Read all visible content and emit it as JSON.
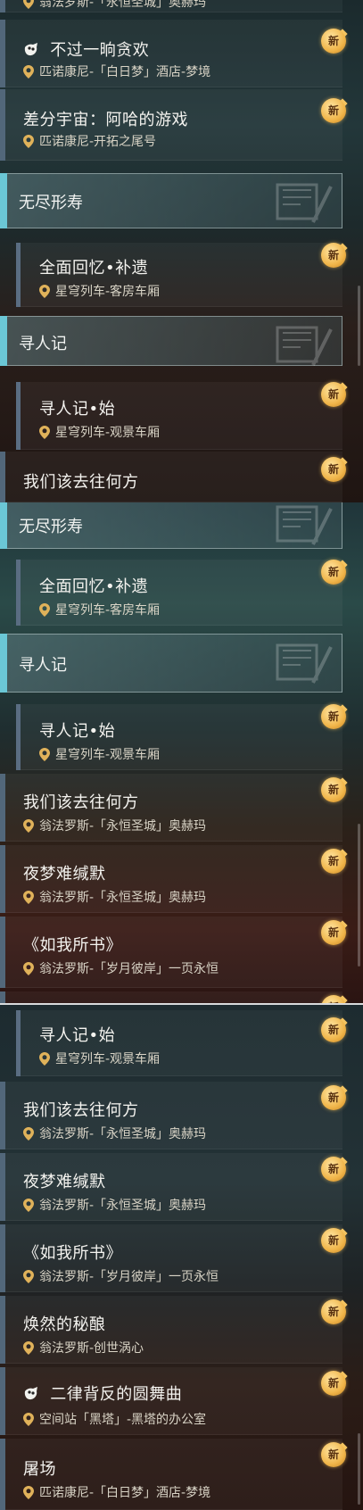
{
  "panel1": {
    "top_loc": "翁法罗斯-「永恒圣城」奥赫玛",
    "rows": [
      {
        "title": "不过一晌贪欢",
        "loc": "匹诺康尼-「白日梦」酒店-梦境",
        "badge": "新",
        "icon": "dream-mask-icon"
      },
      {
        "title": "差分宇宙：阿哈的游戏",
        "loc": "匹诺康尼-开拓之尾号",
        "badge": "新"
      }
    ],
    "section1": "无尽形寿",
    "sub1": {
      "title": "全面回忆•补遗",
      "loc": "星穹列车-客房车厢",
      "badge": "新"
    },
    "section2": "寻人记",
    "sub2": {
      "title": "寻人记•始",
      "loc": "星穹列车-观景车厢",
      "badge": "新"
    },
    "row_last": {
      "title": "我们该去往何方",
      "badge": "新"
    }
  },
  "panel2": {
    "section1": "无尽形寿",
    "sub1": {
      "title": "全面回忆•补遗",
      "loc": "星穹列车-客房车厢",
      "badge": "新"
    },
    "section2": "寻人记",
    "sub2": {
      "title": "寻人记•始",
      "loc": "星穹列车-观景车厢",
      "badge": "新"
    },
    "rows": [
      {
        "title": "我们该去往何方",
        "loc": "翁法罗斯-「永恒圣城」奥赫玛",
        "badge": "新"
      },
      {
        "title": "夜梦难缄默",
        "loc": "翁法罗斯-「永恒圣城」奥赫玛",
        "badge": "新"
      },
      {
        "title": "《如我所书》",
        "loc": "翁法罗斯-「岁月彼岸」一页永恒",
        "badge": "新"
      }
    ],
    "partial_badge": "新"
  },
  "panel3": {
    "sub": {
      "title": "寻人记•始",
      "loc": "星穹列车-观景车厢",
      "badge": "新"
    },
    "rows": [
      {
        "title": "我们该去往何方",
        "loc": "翁法罗斯-「永恒圣城」奥赫玛",
        "badge": "新"
      },
      {
        "title": "夜梦难缄默",
        "loc": "翁法罗斯-「永恒圣城」奥赫玛",
        "badge": "新"
      },
      {
        "title": "《如我所书》",
        "loc": "翁法罗斯-「岁月彼岸」一页永恒",
        "badge": "新"
      },
      {
        "title": "焕然的秘酿",
        "loc": "翁法罗斯-创世涡心",
        "badge": "新"
      },
      {
        "title": "二律背反的圆舞曲",
        "loc": "空间站「黑塔」-黑塔的办公室",
        "badge": "新",
        "icon": "dream-mask-icon"
      },
      {
        "title": "屠场",
        "loc": "匹诺康尼-「白日梦」酒店-梦境",
        "badge": "新"
      }
    ]
  },
  "colors": {
    "accent": "#6bc7d6",
    "badge": "#f0b54a",
    "row_accent": "#52677a"
  }
}
